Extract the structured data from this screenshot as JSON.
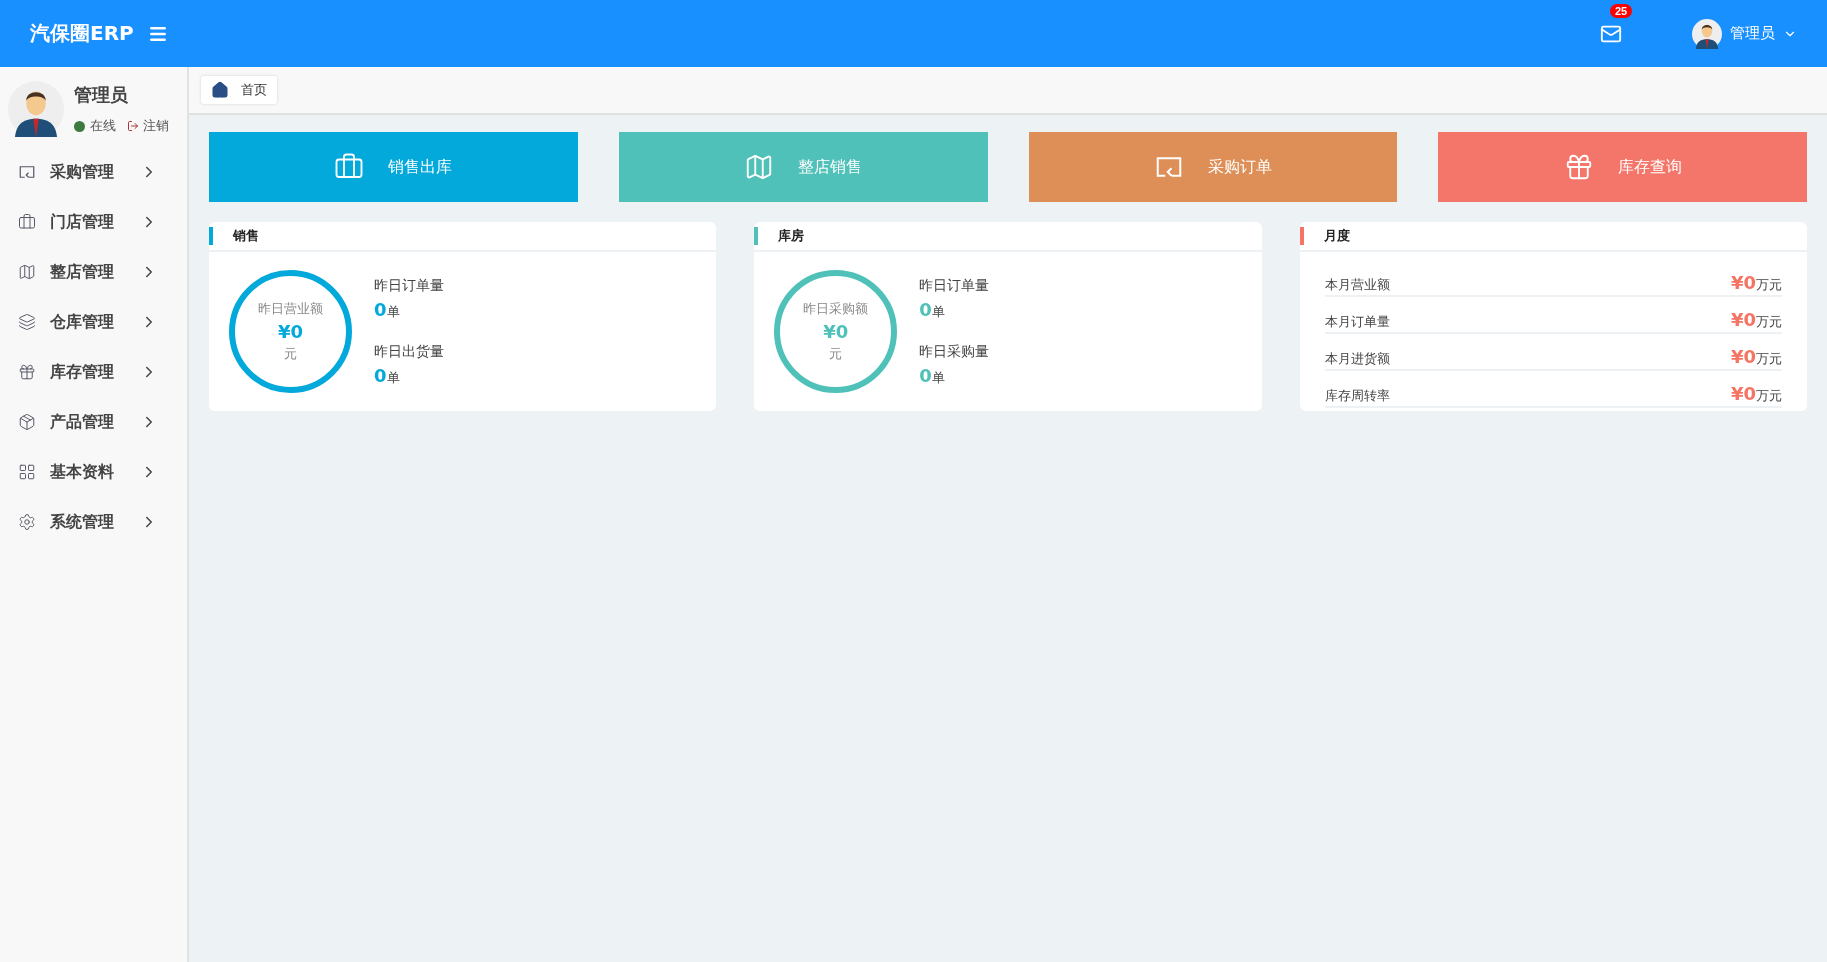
{
  "header": {
    "title": "汽保圈ERP",
    "notification_count": "25",
    "user_name": "管理员"
  },
  "sidebar": {
    "user": {
      "name": "管理员",
      "status": "在线",
      "logout": "注销"
    },
    "items": [
      {
        "label": "采购管理"
      },
      {
        "label": "门店管理"
      },
      {
        "label": "整店管理"
      },
      {
        "label": "仓库管理"
      },
      {
        "label": "库存管理"
      },
      {
        "label": "产品管理"
      },
      {
        "label": "基本资料"
      },
      {
        "label": "系统管理"
      }
    ]
  },
  "breadcrumb": {
    "label": "首页"
  },
  "tiles": [
    {
      "label": "销售出库",
      "color": "#03a9db"
    },
    {
      "label": "整店销售",
      "color": "#50c1b8"
    },
    {
      "label": "采购订单",
      "color": "#dd8f57"
    },
    {
      "label": "库存查询",
      "color": "#f4766a"
    }
  ],
  "panels": [
    {
      "kind": "circle",
      "title": "销售",
      "color": "#03a9db",
      "circle": {
        "label": "昨日营业额",
        "value": "¥0",
        "unit": "元"
      },
      "stats": [
        {
          "label": "昨日订单量",
          "value": "0",
          "unit": "单"
        },
        {
          "label": "昨日出货量",
          "value": "0",
          "unit": "单"
        }
      ]
    },
    {
      "kind": "circle",
      "title": "库房",
      "color": "#4fc1b9",
      "circle": {
        "label": "昨日采购额",
        "value": "¥0",
        "unit": "元"
      },
      "stats": [
        {
          "label": "昨日订单量",
          "value": "0",
          "unit": "单"
        },
        {
          "label": "昨日采购量",
          "value": "0",
          "unit": "单"
        }
      ]
    },
    {
      "kind": "list",
      "title": "月度",
      "color": "#f57463",
      "rows": [
        {
          "label": "本月营业额",
          "value": "¥0",
          "unit": "万元"
        },
        {
          "label": "本月订单量",
          "value": "¥0",
          "unit": "万元"
        },
        {
          "label": "本月进货额",
          "value": "¥0",
          "unit": "万元"
        },
        {
          "label": "库存周转率",
          "value": "¥0",
          "unit": "万元"
        }
      ]
    }
  ]
}
